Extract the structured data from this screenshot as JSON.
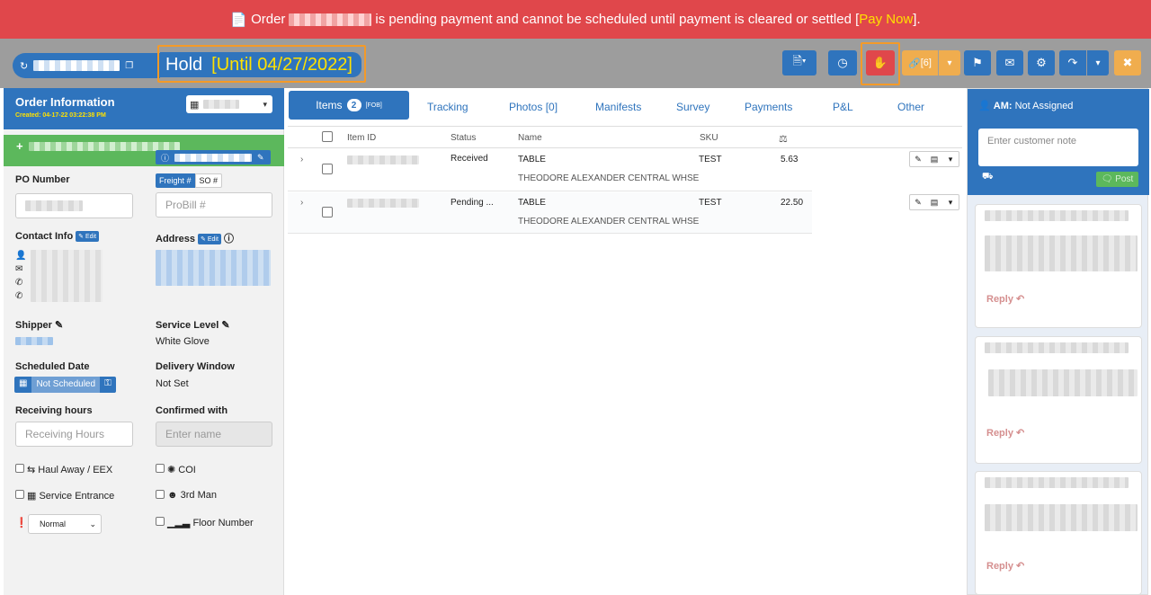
{
  "banner": {
    "prefix": "Order",
    "message": "is pending payment and cannot be scheduled until payment is cleared or settled [",
    "pay_now": "Pay Now",
    "suffix": "]."
  },
  "header": {
    "status": "Hold",
    "until": "[Until 04/27/2022]"
  },
  "toolbar": {
    "link_count": "[6]"
  },
  "order_info": {
    "title": "Order Information",
    "created": "Created: 04-17-22 03:22:38 PM"
  },
  "left": {
    "po_number_label": "PO Number",
    "freight_tab": "Freight #",
    "so_tab": "SO #",
    "probill_placeholder": "ProBill #",
    "contact_label": "Contact Info",
    "edit": "Edit",
    "address_label": "Address",
    "shipper_label": "Shipper",
    "service_level_label": "Service Level",
    "service_level_value": "White Glove",
    "scheduled_date_label": "Scheduled Date",
    "not_scheduled": "Not Scheduled",
    "delivery_window_label": "Delivery Window",
    "delivery_window_value": "Not Set",
    "receiving_hours_label": "Receiving hours",
    "receiving_hours_placeholder": "Receiving Hours",
    "confirmed_with_label": "Confirmed with",
    "enter_name_placeholder": "Enter name",
    "haul_away": "Haul Away / EEX",
    "coi": "COI",
    "service_entrance": "Service Entrance",
    "third_man": "3rd Man",
    "priority_value": "Normal",
    "floor_number": "Floor Number"
  },
  "tabs": {
    "items": "Items",
    "items_count": "2",
    "items_tag": "[FOB]",
    "tracking": "Tracking",
    "photos": "Photos [0]",
    "manifests": "Manifests",
    "survey": "Survey",
    "payments": "Payments",
    "pl": "P&L",
    "other": "Other"
  },
  "grid": {
    "headers": {
      "item_id": "Item ID",
      "status": "Status",
      "name": "Name",
      "sku": "SKU"
    },
    "rows": [
      {
        "status": "Received",
        "name": "TABLE",
        "vendor": "THEODORE ALEXANDER CENTRAL WHSE",
        "sku": "TEST",
        "weight": "5.63"
      },
      {
        "status": "Pending ...",
        "name": "TABLE",
        "vendor": "THEODORE ALEXANDER CENTRAL WHSE",
        "sku": "TEST",
        "weight": "22.50"
      }
    ]
  },
  "right": {
    "am_label": "AM:",
    "am_value": "Not Assigned",
    "note_placeholder": "Enter customer note",
    "post": "Post",
    "reply": "Reply"
  },
  "colors": {
    "banner": "#e0474b",
    "primary": "#2f74bd",
    "success": "#5cb85c",
    "warning": "#f0ad4e",
    "highlight": "#f49a28",
    "danger": "#e0474b"
  }
}
